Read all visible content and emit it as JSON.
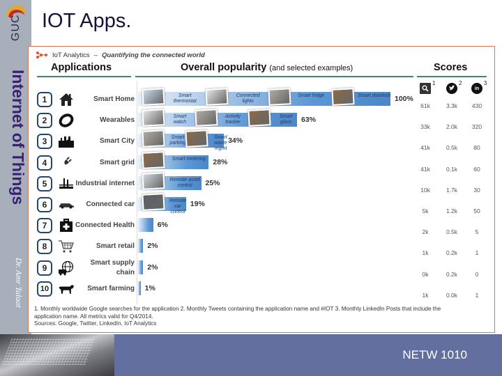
{
  "slide": {
    "title": "IOT Apps.",
    "logo_text": "GUC",
    "vertical_title": "Internet of Things",
    "author": "Dr. Amr Talaat",
    "course_code": "NETW 1010"
  },
  "infographic": {
    "brand": "IoT Analytics",
    "brand_dash": "–",
    "brand_tagline": "Quantifying the connected world",
    "headers": {
      "applications": "Applications",
      "popularity": "Overall popularity",
      "popularity_sub": "(and selected examples)",
      "scores": "Scores"
    },
    "score_columns": [
      {
        "icon": "search-icon",
        "sup": "1"
      },
      {
        "icon": "twitter-icon",
        "sup": "2"
      },
      {
        "icon": "linkedin-icon",
        "sup": "3"
      }
    ],
    "footnote_line1": "1. Monthly worldwide Google searches for the application  2. Monthly Tweets containing the application name and #IOT  3. Monthly LinkedIn Posts that include the",
    "footnote_line2": "application name.  All metrics valid for Q4/2014.",
    "footnote_line3": "Sources: Google, Twitter, LinkedIn, IoT Analytics"
  },
  "chart_data": {
    "type": "bar",
    "title": "IoT Analytics – Quantifying the connected world",
    "xlabel": "Overall popularity (and selected examples)",
    "ylabel": "Applications",
    "categories": [
      "Smart Home",
      "Wearables",
      "Smart City",
      "Smart grid",
      "Industrial internet",
      "Connected car",
      "Connected Health",
      "Smart retail",
      "Smart supply chain",
      "Smart farming"
    ],
    "ranks": [
      "1",
      "2",
      "3",
      "4",
      "5",
      "6",
      "7",
      "8",
      "9",
      "10"
    ],
    "icons": [
      "house-icon",
      "wristband-icon",
      "factory-city-icon",
      "plug-icon",
      "industrial-plant-icon",
      "car-icon",
      "medical-kit-icon",
      "shopping-cart-icon",
      "globe-truck-icon",
      "cow-icon"
    ],
    "values": [
      100,
      63,
      34,
      28,
      25,
      19,
      6,
      2,
      2,
      1
    ],
    "value_labels": [
      "100%",
      "63%",
      "34%",
      "28%",
      "25%",
      "19%",
      "6%",
      "2%",
      "2%",
      "1%"
    ],
    "xlim": [
      0,
      100
    ],
    "examples": [
      [
        "Smart thermostat",
        "Connected lights",
        "Smart fridge",
        "Smart doorlock"
      ],
      [
        "Smart watch",
        "Activity tracker",
        "Smart glass"
      ],
      [
        "Smart parking",
        "Smart waste mgmt"
      ],
      [
        "Smart metering"
      ],
      [
        "Remote asset control"
      ],
      [
        "Remote car control"
      ],
      [],
      [],
      [],
      []
    ],
    "scores": {
      "columns": [
        "Monthly Google searches",
        "Monthly Tweets",
        "Monthly LinkedIn posts"
      ],
      "google": [
        "61k",
        "33k",
        "41k",
        "41k",
        "10k",
        "5k",
        "2k",
        "1k",
        "0k",
        "1k"
      ],
      "twitter": [
        "3.3k",
        "2.0k",
        "0.5k",
        "0.1k",
        "1.7k",
        "1.2k",
        "0.5k",
        "0.2k",
        "0.2k",
        "0.0k"
      ],
      "linkedin": [
        "430",
        "320",
        "80",
        "60",
        "30",
        "50",
        "5",
        "1",
        "0",
        "1"
      ]
    },
    "legend": "none",
    "grid": false
  },
  "colors": {
    "bar": "#5b96d5",
    "rule": "#3e8a6c",
    "badge_border": "#22466d",
    "frame": "#d7785a",
    "left_band": "#a7afbb",
    "bottom_bar": "#63709f",
    "title_text": "#14123a",
    "vertical_title": "#3b1f73"
  }
}
